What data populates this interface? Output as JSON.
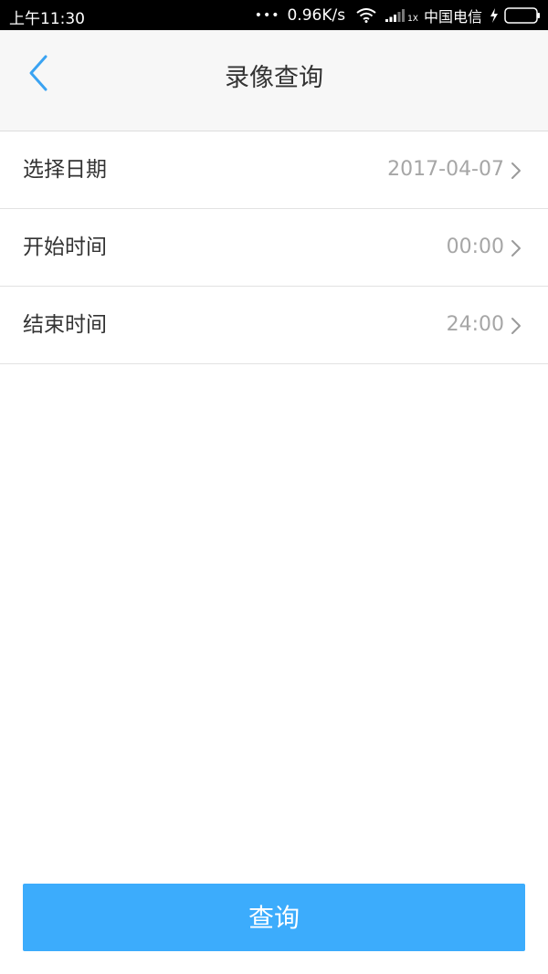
{
  "status_bar": {
    "time": "上午11:30",
    "dots": "•••",
    "speed": "0.96K/s",
    "signal_sub": "1X",
    "carrier": "中国电信",
    "icons": [
      "wifi-icon",
      "signal-icon",
      "charge-icon",
      "battery-icon"
    ]
  },
  "header": {
    "back_icon": "chevron-left-icon",
    "title": "录像查询"
  },
  "rows": [
    {
      "label": "选择日期",
      "value": "2017-04-07"
    },
    {
      "label": "开始时间",
      "value": "00:00"
    },
    {
      "label": "结束时间",
      "value": "24:00"
    }
  ],
  "query_button": {
    "label": "查询"
  },
  "colors": {
    "accent": "#3cacfc",
    "header_bg": "#f7f7f7",
    "title_text": "#333333",
    "value_text": "#a6a6a6",
    "divider": "#e2e2e2"
  }
}
